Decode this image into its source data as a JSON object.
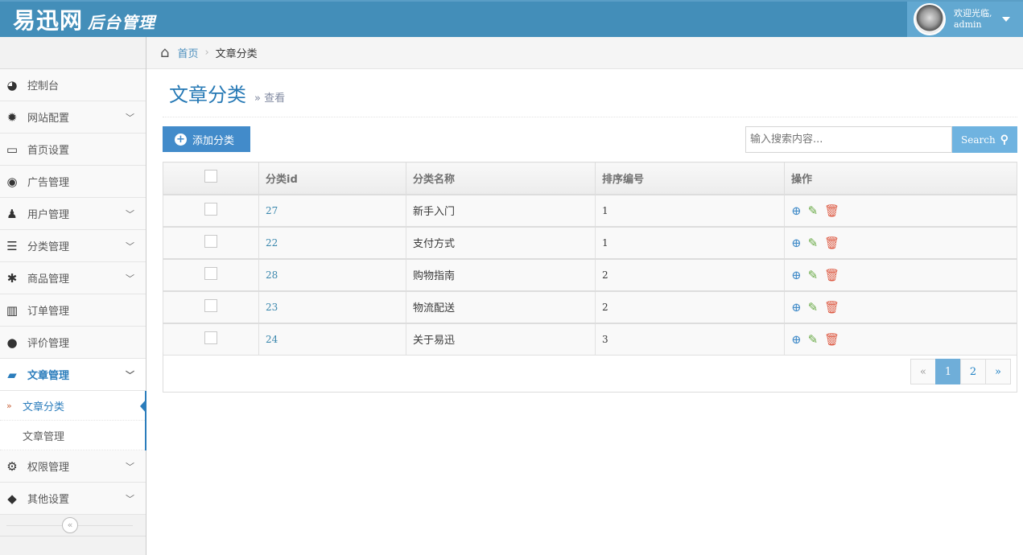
{
  "header": {
    "logo_main": "易迅网",
    "logo_sub": "后台管理",
    "welcome": "欢迎光临,",
    "username": "admin"
  },
  "sidebar": {
    "items": [
      {
        "label": "控制台",
        "icon": "dashboard-icon",
        "glyph": "◕",
        "arrow": false
      },
      {
        "label": "网站配置",
        "icon": "gear-icon",
        "glyph": "✹",
        "arrow": true
      },
      {
        "label": "首页设置",
        "icon": "desktop-icon",
        "glyph": "▭",
        "arrow": false
      },
      {
        "label": "广告管理",
        "icon": "eye-icon",
        "glyph": "◉",
        "arrow": false
      },
      {
        "label": "用户管理",
        "icon": "users-icon",
        "glyph": "♟",
        "arrow": true
      },
      {
        "label": "分类管理",
        "icon": "list-icon",
        "glyph": "☰",
        "arrow": true
      },
      {
        "label": "商品管理",
        "icon": "asterisk-icon",
        "glyph": "✱",
        "arrow": true
      },
      {
        "label": "订单管理",
        "icon": "bar-chart-icon",
        "glyph": "▥",
        "arrow": false
      },
      {
        "label": "评价管理",
        "icon": "comment-icon",
        "glyph": "●",
        "arrow": false
      },
      {
        "label": "文章管理",
        "icon": "book-icon",
        "glyph": "▰",
        "arrow": true
      }
    ],
    "submenu": [
      {
        "label": "文章分类"
      },
      {
        "label": "文章管理"
      }
    ],
    "items_after": [
      {
        "label": "权限管理",
        "icon": "cogs-icon",
        "glyph": "⚙"
      },
      {
        "label": "其他设置",
        "icon": "tag-icon",
        "glyph": "◆"
      }
    ],
    "collapse": "«"
  },
  "breadcrumb": {
    "home": "首页",
    "current": "文章分类"
  },
  "page": {
    "title": "文章分类",
    "subtitle": "» 查看"
  },
  "toolbar": {
    "add_label": "添加分类",
    "search_placeholder": "输入搜索内容...",
    "search_label": "Search"
  },
  "table": {
    "headers": [
      "分类id",
      "分类名称",
      "排序编号",
      "操作"
    ],
    "rows": [
      {
        "id": "27",
        "name": "新手入门",
        "order": "1"
      },
      {
        "id": "22",
        "name": "支付方式",
        "order": "1"
      },
      {
        "id": "28",
        "name": "购物指南",
        "order": "2"
      },
      {
        "id": "23",
        "name": "物流配送",
        "order": "2"
      },
      {
        "id": "24",
        "name": "关于易迅",
        "order": "3"
      }
    ]
  },
  "pagination": {
    "prev": "«",
    "pages": [
      "1",
      "2"
    ],
    "current": "1",
    "next": "»"
  },
  "colors": {
    "accent": "#438eb9",
    "view": "#478fca",
    "edit": "#69aa46",
    "delete": "#dd5a43"
  }
}
